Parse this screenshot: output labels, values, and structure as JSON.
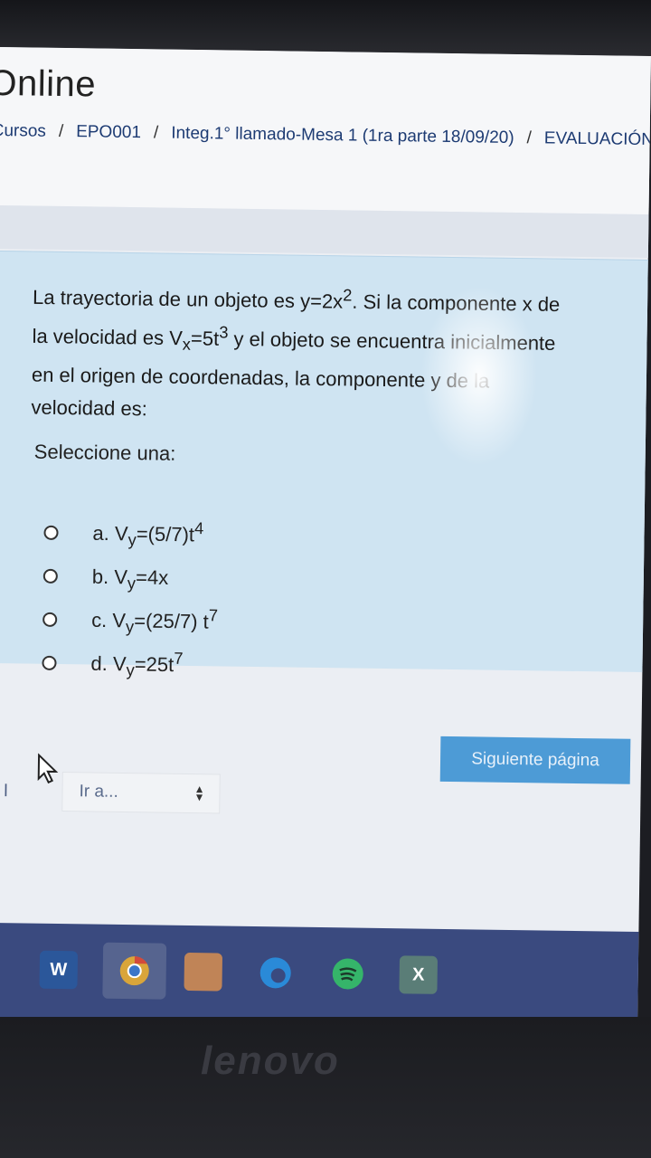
{
  "header": {
    "site_title": "Online",
    "breadcrumb": [
      "Cursos",
      "EPO001",
      "Integ.1° llamado-Mesa 1 (1ra parte 18/09/20)",
      "EVALUACIÓN"
    ]
  },
  "question": {
    "line1_a": "La trayectoria de un objeto es y=2x",
    "line1_b": ". Si la componente x de",
    "line2_a": "la velocidad es V",
    "line2_b": "=5t",
    "line2_c": " y el objeto se encuentra inicialmente",
    "line3": "en el origen de coordenadas, la componente y de la",
    "line4": "velocidad es:",
    "sup_2": "2",
    "sub_x": "x",
    "sup_3": "3",
    "select_label": "Seleccione una:",
    "options": [
      {
        "prefix": "a. V",
        "sub": "y",
        "body": "=(5/7)t",
        "sup": "4"
      },
      {
        "prefix": "b. V",
        "sub": "y",
        "body": "=4x",
        "sup": ""
      },
      {
        "prefix": "c. V",
        "sub": "y",
        "body": "=(25/7) t",
        "sup": "7"
      },
      {
        "prefix": "d. V",
        "sub": "y",
        "body": "=25t",
        "sup": "7"
      }
    ]
  },
  "navigation": {
    "next_label": "Siguiente página",
    "left_partial": "a l",
    "jump_placeholder": "Ir a..."
  },
  "taskbar": {
    "icons": [
      "windows-start-icon",
      "word-icon",
      "chrome-icon",
      "app-icon",
      "edge-icon",
      "spotify-icon",
      "excel-icon"
    ]
  },
  "bezel": {
    "brand": "lenovo"
  }
}
